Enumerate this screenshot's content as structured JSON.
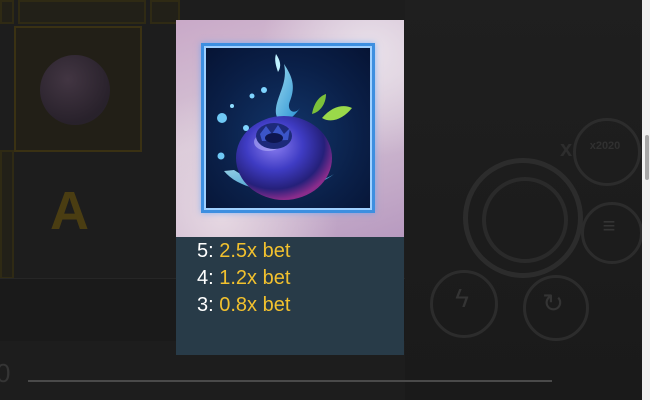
{
  "background": {
    "dim_letter": "A",
    "edge_number": "0",
    "turbo_label": "x2020",
    "turbo_prefix": "x"
  },
  "popup": {
    "symbol_icon": "blueberry-symbol-icon",
    "frame_color": "#3d8fe0",
    "paytable": [
      {
        "count": "5:",
        "multiplier": "2.5x bet"
      },
      {
        "count": "4:",
        "multiplier": "1.2x bet"
      },
      {
        "count": "3:",
        "multiplier": "0.8x bet"
      }
    ],
    "count_color": "#ffffff",
    "multiplier_color": "#f2c12e"
  }
}
